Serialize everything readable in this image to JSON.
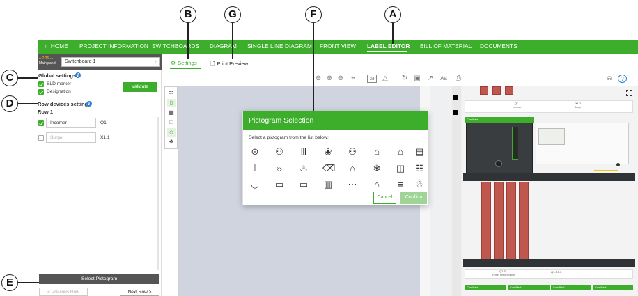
{
  "callouts": {
    "a": "A",
    "b": "B",
    "c": "C",
    "d": "D",
    "e": "E",
    "f": "F",
    "g": "G"
  },
  "nav": {
    "home": "HOME",
    "items": [
      "PROJECT INFORMATION",
      "SWITCHBOARDS",
      "DIAGRAM",
      "SINGLE LINE DIAGRAM",
      "FRONT VIEW",
      "LABEL EDITOR",
      "BILL OF MATERIAL",
      "DOCUMENTS"
    ],
    "active_index": 5
  },
  "switchboard_bar": {
    "badge_line1": "● 2 36 ---",
    "badge_line2": "Main panel",
    "name": "Switchboard 1"
  },
  "tabs": {
    "settings": "Settings",
    "print_preview": "Print Preview"
  },
  "global_settings": {
    "title": "Global settings",
    "options": [
      {
        "label": "SLD marker",
        "checked": true
      },
      {
        "label": "Designation",
        "checked": true
      }
    ],
    "validate_label": "Validate"
  },
  "row_devices": {
    "title": "Row devices setting",
    "row_label": "Row 1",
    "devices": [
      {
        "name": "Incomer",
        "id": "Q1",
        "checked": true
      },
      {
        "name": "Surge",
        "id": "X1.1",
        "checked": false
      }
    ]
  },
  "footer": {
    "select_pictogram": "Select Pictogram",
    "previous_row": "< Previous Row",
    "next_row": "Next Row >"
  },
  "dialog": {
    "title": "Pictogram Selection",
    "instruction": "Select a pictogram from the list below:",
    "cancel": "Cancel",
    "confirm": "Confirm"
  },
  "right_panel": {
    "label_q1": "Q1",
    "label_q1_sub": "Incomer",
    "label_x11": "X1.1",
    "label_x11_sub": "Surge",
    "label_q13": "Q1.3",
    "label_q13_sub": "Power Feeder circuit",
    "label_q133": "Q1.3.3.3",
    "device_brand": "ComPact"
  },
  "colors": {
    "accent": "#3dae2b",
    "dark": "#555555",
    "copper": "#c0574e",
    "canvas": "#cfd4de",
    "link": "#2a7fd4"
  }
}
